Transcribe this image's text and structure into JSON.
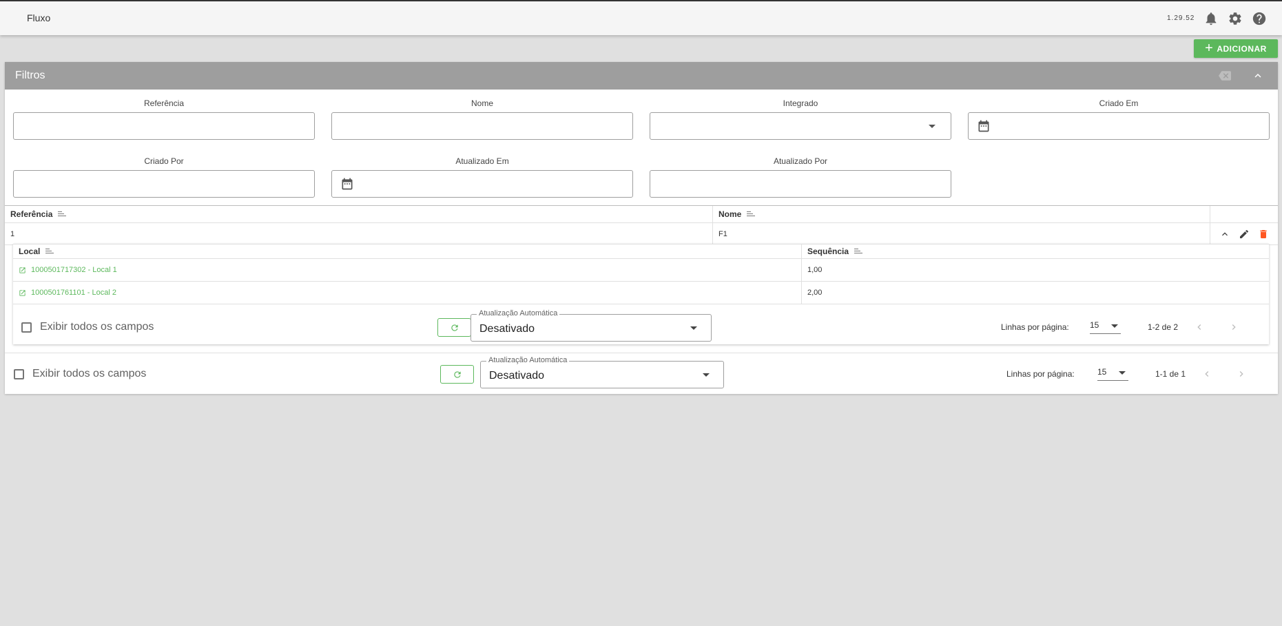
{
  "app": {
    "title": "Fluxo",
    "version": "1.29.52"
  },
  "icons": {
    "bell": "bell-icon",
    "settings": "gear-icon",
    "help": "help-icon"
  },
  "toolbar": {
    "add_label": "ADICIONAR",
    "add_color": "#5cb85c"
  },
  "filters": {
    "title": "Filtros",
    "fields": {
      "referencia": {
        "label": "Referência",
        "value": ""
      },
      "nome": {
        "label": "Nome",
        "value": ""
      },
      "integrado": {
        "label": "Integrado",
        "value": ""
      },
      "criado_em": {
        "label": "Criado Em",
        "value": ""
      },
      "criado_por": {
        "label": "Criado Por",
        "value": ""
      },
      "atualizado_em": {
        "label": "Atualizado Em",
        "value": ""
      },
      "atualizado_por": {
        "label": "Atualizado Por",
        "value": ""
      }
    }
  },
  "grid": {
    "columns": {
      "referencia": "Referência",
      "nome": "Nome"
    },
    "rows": [
      {
        "referencia": "1",
        "nome": "F1"
      }
    ]
  },
  "subgrid": {
    "columns": {
      "local": "Local",
      "sequencia": "Sequência"
    },
    "rows": [
      {
        "local": "1000501717302 - Local 1",
        "sequencia": "1,00"
      },
      {
        "local": "1000501761101 - Local 2",
        "sequencia": "2,00"
      }
    ],
    "footer": {
      "show_all": "Exibir todos os campos",
      "auto_update_label": "Atualização Automática",
      "auto_update_value": "Desativado",
      "rows_per_page_label": "Linhas por página:",
      "rows_per_page": "15",
      "range": "1-2 de 2"
    }
  },
  "main_footer": {
    "show_all": "Exibir todos os campos",
    "auto_update_label": "Atualização Automática",
    "auto_update_value": "Desativado",
    "rows_per_page_label": "Linhas por página:",
    "rows_per_page": "15",
    "range": "1-1 de 1"
  }
}
